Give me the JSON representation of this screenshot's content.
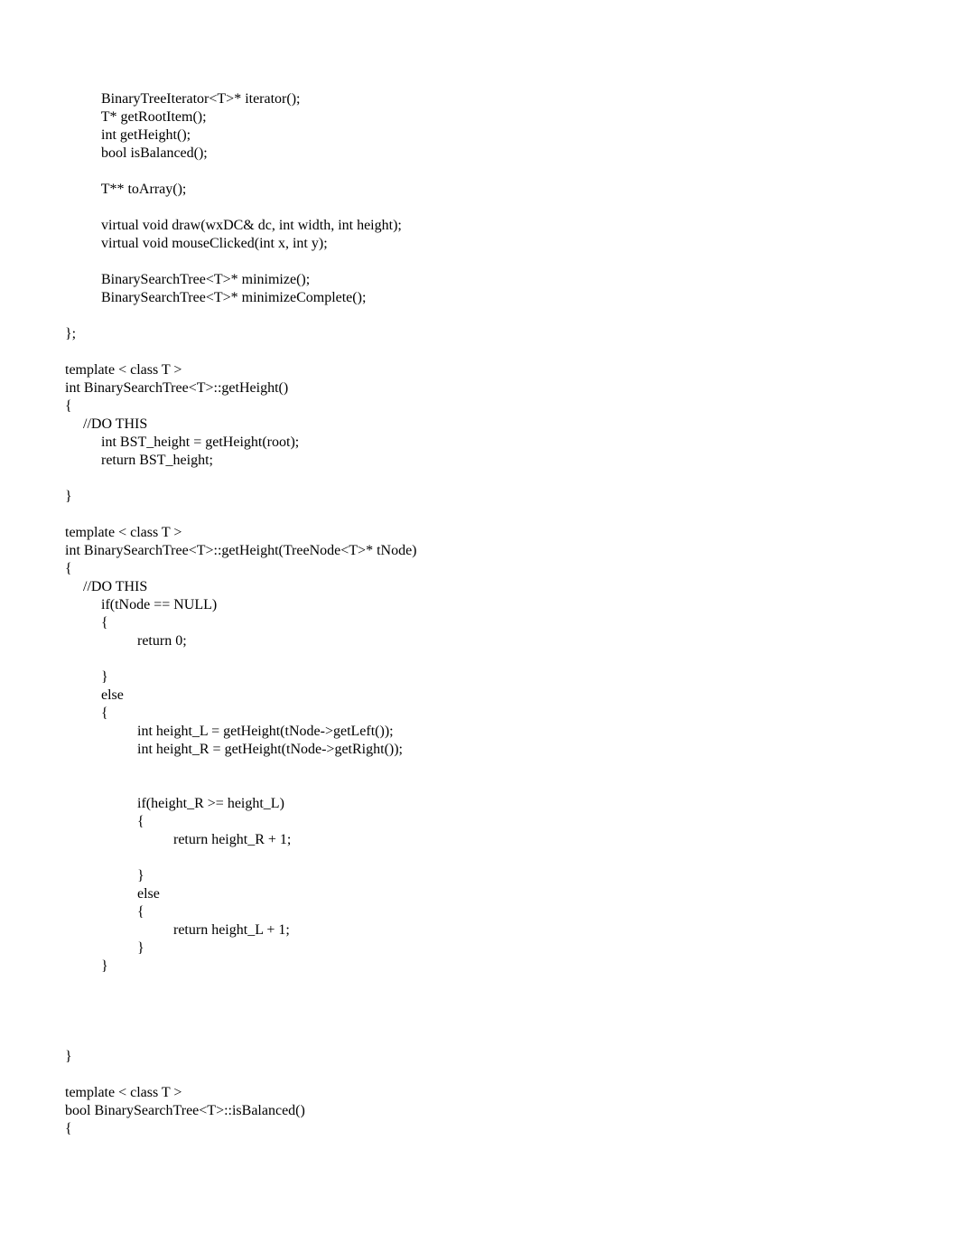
{
  "code": {
    "lines": [
      "          BinaryTreeIterator<T>* iterator();",
      "          T* getRootItem();",
      "          int getHeight();",
      "          bool isBalanced();",
      "",
      "          T** toArray();",
      "",
      "          virtual void draw(wxDC& dc, int width, int height);",
      "          virtual void mouseClicked(int x, int y);",
      "",
      "          BinarySearchTree<T>* minimize();",
      "          BinarySearchTree<T>* minimizeComplete();",
      "",
      "};",
      "",
      "template < class T >",
      "int BinarySearchTree<T>::getHeight()",
      "{",
      "     //DO THIS",
      "          int BST_height = getHeight(root);",
      "          return BST_height;",
      "",
      "}",
      "",
      "template < class T >",
      "int BinarySearchTree<T>::getHeight(TreeNode<T>* tNode)",
      "{",
      "     //DO THIS",
      "          if(tNode == NULL)",
      "          {",
      "                    return 0;",
      "",
      "          }",
      "          else",
      "          {",
      "                    int height_L = getHeight(tNode->getLeft());",
      "                    int height_R = getHeight(tNode->getRight());",
      "",
      "",
      "                    if(height_R >= height_L)",
      "                    {",
      "                              return height_R + 1;",
      "",
      "                    }",
      "                    else",
      "                    {",
      "                              return height_L + 1;",
      "                    }",
      "          }",
      "",
      "",
      "",
      "",
      "}",
      "",
      "template < class T >",
      "bool BinarySearchTree<T>::isBalanced()",
      "{"
    ]
  }
}
